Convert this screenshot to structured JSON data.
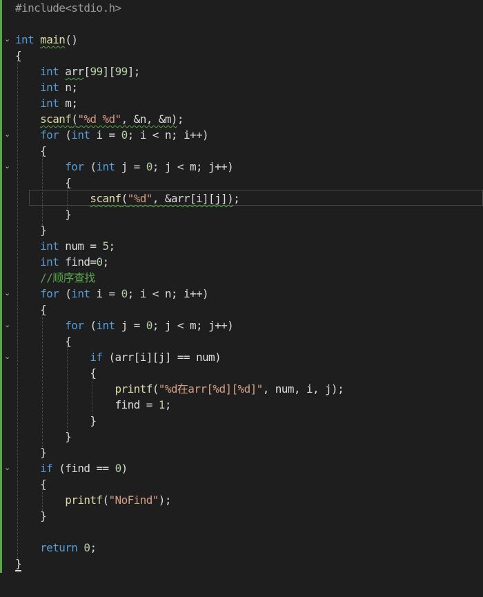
{
  "editor": {
    "lines": [
      {
        "tokens": [
          {
            "t": "#include",
            "c": "pp"
          },
          {
            "t": "<stdio.h>",
            "c": "pp"
          }
        ]
      },
      {
        "tokens": []
      },
      {
        "tokens": [
          {
            "t": "int",
            "c": "kw"
          },
          {
            "t": " ",
            "c": ""
          },
          {
            "t": "main",
            "c": "fn squig"
          },
          {
            "t": "()",
            "c": ""
          }
        ],
        "fold": true
      },
      {
        "tokens": [
          {
            "t": "{",
            "c": ""
          }
        ]
      },
      {
        "tokens": [
          {
            "t": "    ",
            "c": ""
          },
          {
            "t": "int",
            "c": "kw"
          },
          {
            "t": " ",
            "c": ""
          },
          {
            "t": "arr",
            "c": "var squig"
          },
          {
            "t": "[",
            "c": ""
          },
          {
            "t": "99",
            "c": "num"
          },
          {
            "t": "][",
            "c": ""
          },
          {
            "t": "99",
            "c": "num"
          },
          {
            "t": "];",
            "c": ""
          }
        ]
      },
      {
        "tokens": [
          {
            "t": "    ",
            "c": ""
          },
          {
            "t": "int",
            "c": "kw"
          },
          {
            "t": " n;",
            "c": ""
          }
        ]
      },
      {
        "tokens": [
          {
            "t": "    ",
            "c": ""
          },
          {
            "t": "int",
            "c": "kw"
          },
          {
            "t": " m;",
            "c": ""
          }
        ]
      },
      {
        "tokens": [
          {
            "t": "    ",
            "c": ""
          },
          {
            "t": "scanf",
            "c": "fn squig"
          },
          {
            "t": "(",
            "c": "squig"
          },
          {
            "t": "\"%d %d\"",
            "c": "str squig"
          },
          {
            "t": ", &n, &m)",
            "c": "squig"
          },
          {
            "t": ";",
            "c": ""
          }
        ]
      },
      {
        "tokens": [
          {
            "t": "    ",
            "c": ""
          },
          {
            "t": "for",
            "c": "kw"
          },
          {
            "t": " (",
            "c": ""
          },
          {
            "t": "int",
            "c": "kw"
          },
          {
            "t": " i = ",
            "c": ""
          },
          {
            "t": "0",
            "c": "num"
          },
          {
            "t": "; i < n; i++)",
            "c": ""
          }
        ],
        "fold": true
      },
      {
        "tokens": [
          {
            "t": "    {",
            "c": ""
          }
        ]
      },
      {
        "tokens": [
          {
            "t": "        ",
            "c": ""
          },
          {
            "t": "for",
            "c": "kw"
          },
          {
            "t": " (",
            "c": ""
          },
          {
            "t": "int",
            "c": "kw"
          },
          {
            "t": " j = ",
            "c": ""
          },
          {
            "t": "0",
            "c": "num"
          },
          {
            "t": "; j < m; j++)",
            "c": ""
          }
        ],
        "fold": true
      },
      {
        "tokens": [
          {
            "t": "        {",
            "c": ""
          }
        ]
      },
      {
        "tokens": [
          {
            "t": "            ",
            "c": ""
          },
          {
            "t": "scanf",
            "c": "fn squig"
          },
          {
            "t": "(",
            "c": "squig"
          },
          {
            "t": "\"%d\"",
            "c": "str squig"
          },
          {
            "t": ", &arr[i][j])",
            "c": "squig"
          },
          {
            "t": ";",
            "c": ""
          }
        ],
        "current": true
      },
      {
        "tokens": [
          {
            "t": "        }",
            "c": ""
          }
        ]
      },
      {
        "tokens": [
          {
            "t": "    }",
            "c": ""
          }
        ]
      },
      {
        "tokens": [
          {
            "t": "    ",
            "c": ""
          },
          {
            "t": "int",
            "c": "kw"
          },
          {
            "t": " num = ",
            "c": ""
          },
          {
            "t": "5",
            "c": "num"
          },
          {
            "t": ";",
            "c": ""
          }
        ]
      },
      {
        "tokens": [
          {
            "t": "    ",
            "c": ""
          },
          {
            "t": "int",
            "c": "kw"
          },
          {
            "t": " find=",
            "c": ""
          },
          {
            "t": "0",
            "c": "num"
          },
          {
            "t": ";",
            "c": ""
          }
        ]
      },
      {
        "tokens": [
          {
            "t": "    ",
            "c": ""
          },
          {
            "t": "//顺序查找",
            "c": "cm"
          }
        ]
      },
      {
        "tokens": [
          {
            "t": "    ",
            "c": ""
          },
          {
            "t": "for",
            "c": "kw"
          },
          {
            "t": " (",
            "c": ""
          },
          {
            "t": "int",
            "c": "kw"
          },
          {
            "t": " i = ",
            "c": ""
          },
          {
            "t": "0",
            "c": "num"
          },
          {
            "t": "; i < n; i++)",
            "c": ""
          }
        ],
        "fold": true
      },
      {
        "tokens": [
          {
            "t": "    {",
            "c": ""
          }
        ]
      },
      {
        "tokens": [
          {
            "t": "        ",
            "c": ""
          },
          {
            "t": "for",
            "c": "kw"
          },
          {
            "t": " (",
            "c": ""
          },
          {
            "t": "int",
            "c": "kw"
          },
          {
            "t": " j = ",
            "c": ""
          },
          {
            "t": "0",
            "c": "num"
          },
          {
            "t": "; j < m; j++)",
            "c": ""
          }
        ],
        "fold": true
      },
      {
        "tokens": [
          {
            "t": "        {",
            "c": ""
          }
        ]
      },
      {
        "tokens": [
          {
            "t": "            ",
            "c": ""
          },
          {
            "t": "if",
            "c": "kw"
          },
          {
            "t": " (arr[i][j] == num)",
            "c": ""
          }
        ],
        "fold": true
      },
      {
        "tokens": [
          {
            "t": "            {",
            "c": ""
          }
        ]
      },
      {
        "tokens": [
          {
            "t": "                ",
            "c": ""
          },
          {
            "t": "printf",
            "c": "fn"
          },
          {
            "t": "(",
            "c": ""
          },
          {
            "t": "\"%d在arr[%d][%d]\"",
            "c": "str"
          },
          {
            "t": ", num, i, j);",
            "c": ""
          }
        ]
      },
      {
        "tokens": [
          {
            "t": "                find = ",
            "c": ""
          },
          {
            "t": "1",
            "c": "num"
          },
          {
            "t": ";",
            "c": ""
          }
        ]
      },
      {
        "tokens": [
          {
            "t": "            }",
            "c": ""
          }
        ]
      },
      {
        "tokens": [
          {
            "t": "        }",
            "c": ""
          }
        ]
      },
      {
        "tokens": [
          {
            "t": "    }",
            "c": ""
          }
        ]
      },
      {
        "tokens": [
          {
            "t": "    ",
            "c": ""
          },
          {
            "t": "if",
            "c": "kw"
          },
          {
            "t": " (find == ",
            "c": ""
          },
          {
            "t": "0",
            "c": "num"
          },
          {
            "t": ")",
            "c": ""
          }
        ],
        "fold": true
      },
      {
        "tokens": [
          {
            "t": "    {",
            "c": ""
          }
        ]
      },
      {
        "tokens": [
          {
            "t": "        ",
            "c": ""
          },
          {
            "t": "printf",
            "c": "fn"
          },
          {
            "t": "(",
            "c": ""
          },
          {
            "t": "\"NoFind\"",
            "c": "str"
          },
          {
            "t": ");",
            "c": ""
          }
        ]
      },
      {
        "tokens": [
          {
            "t": "    }",
            "c": ""
          }
        ]
      },
      {
        "tokens": []
      },
      {
        "tokens": [
          {
            "t": "    ",
            "c": ""
          },
          {
            "t": "return",
            "c": "kw"
          },
          {
            "t": " ",
            "c": ""
          },
          {
            "t": "0",
            "c": "num"
          },
          {
            "t": ";",
            "c": ""
          }
        ]
      },
      {
        "tokens": [
          {
            "t": "}",
            "c": "caret-end"
          }
        ]
      }
    ]
  }
}
